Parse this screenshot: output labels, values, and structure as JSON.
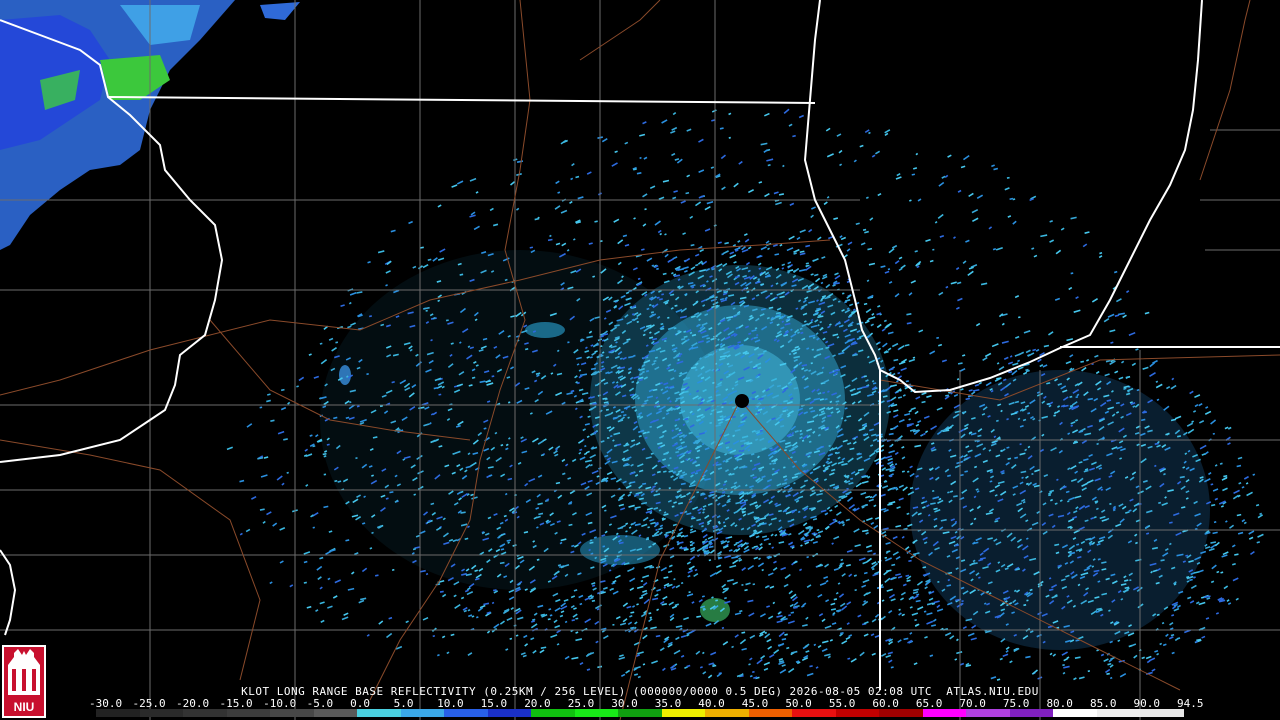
{
  "product_header": "KLOT LONG RANGE BASE REFLECTIVITY (0.25KM / 256 LEVEL) (000000/0000 0.5 DEG) 2026-08-05 02:08 UTC  ATLAS.NIU.EDU",
  "logo_text": "NIU",
  "scale": {
    "labels": [
      "-30.0",
      "-25.0",
      "-20.0",
      "-15.0",
      "-10.0",
      "-5.0",
      "0.0",
      "5.0",
      "10.0",
      "15.0",
      "20.0",
      "25.0",
      "30.0",
      "35.0",
      "40.0",
      "45.0",
      "50.0",
      "55.0",
      "60.0",
      "65.0",
      "70.0",
      "75.0",
      "80.0",
      "85.0",
      "90.0",
      "94.5"
    ],
    "colors": [
      "#222222",
      "#2a2a2a",
      "#333333",
      "#3c3c3c",
      "#474747",
      "#595959",
      "#4ad0e0",
      "#3aa8e8",
      "#2860e8",
      "#1a30c8",
      "#10c010",
      "#18e818",
      "#10a010",
      "#f0f000",
      "#f0b000",
      "#f06000",
      "#e81010",
      "#c00000",
      "#a00000",
      "#ff00ff",
      "#b040e0",
      "#8020c0",
      "#ffffff",
      "#f0f0f0",
      "#e8e8e8"
    ]
  },
  "icons": [
    "radar-site-icon",
    "niu-logo"
  ]
}
